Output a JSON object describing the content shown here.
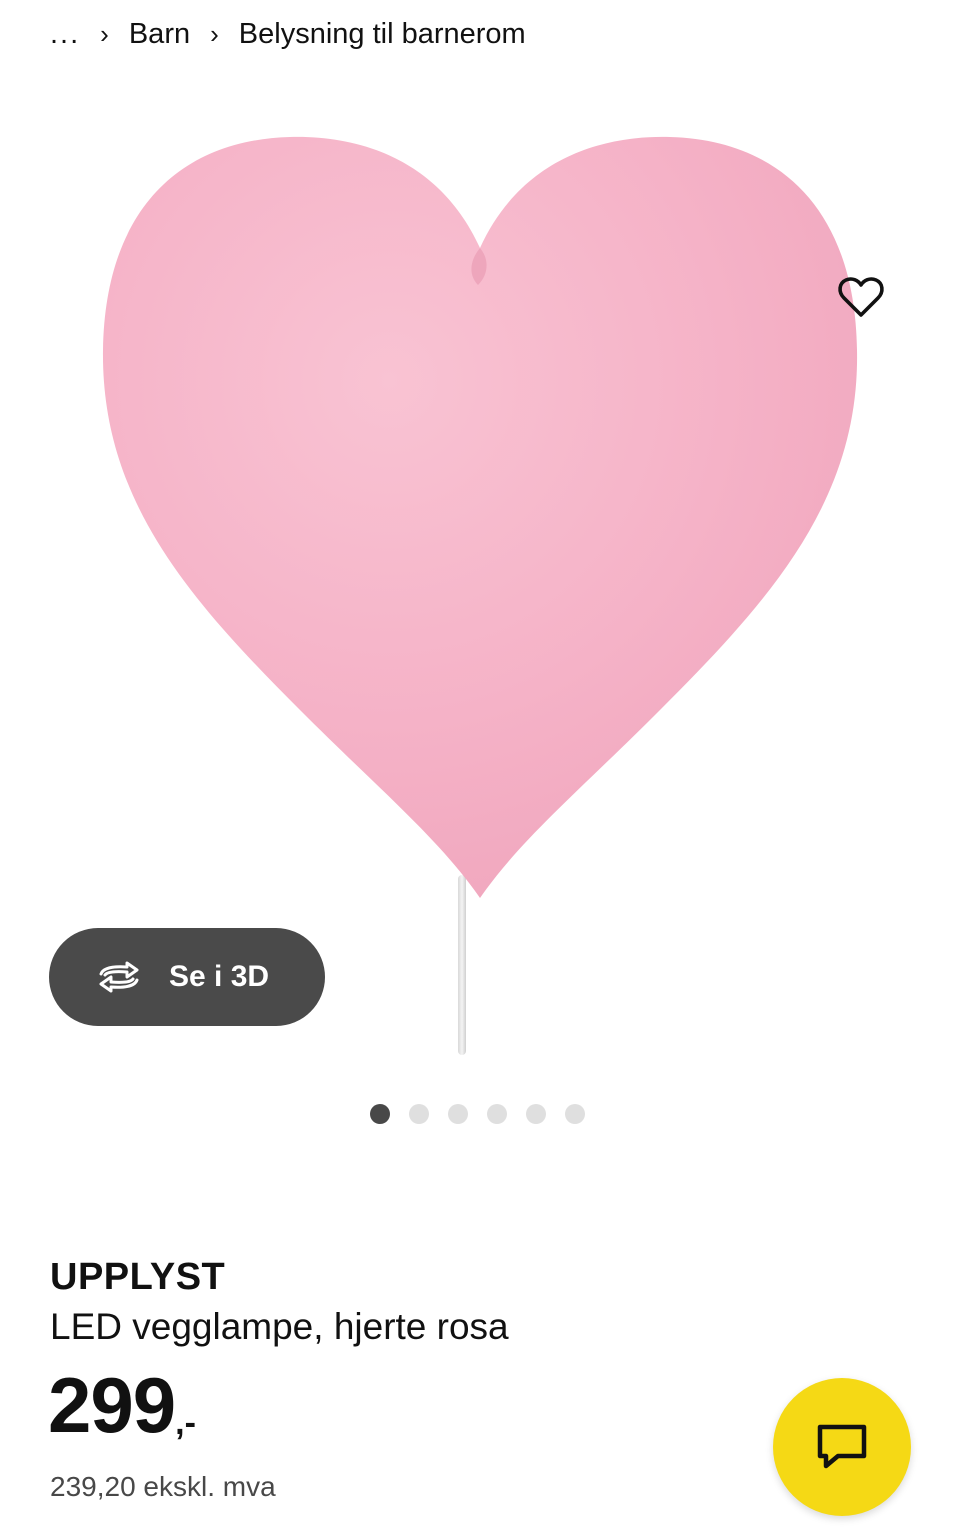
{
  "breadcrumb": {
    "ellipsis": "...",
    "items": [
      "Barn",
      "Belysning til barnerom"
    ]
  },
  "gallery": {
    "view_3d_label": "Se i 3D",
    "dot_count": 6,
    "active_index": 0
  },
  "product": {
    "name": "UPPLYST",
    "description": "LED vegglampe, hjerte rosa",
    "price_integer": "299",
    "price_suffix": ",-",
    "price_excl_vat": "239,20 ekskl. mva"
  },
  "colors": {
    "chat_button": "#f5d915",
    "view3d_button": "#4a4a4a",
    "heart": "#f5b0c6"
  },
  "icons": {
    "favorite": "heart-outline-icon",
    "view3d": "rotate-3d-icon",
    "chat": "chat-bubble-icon"
  }
}
